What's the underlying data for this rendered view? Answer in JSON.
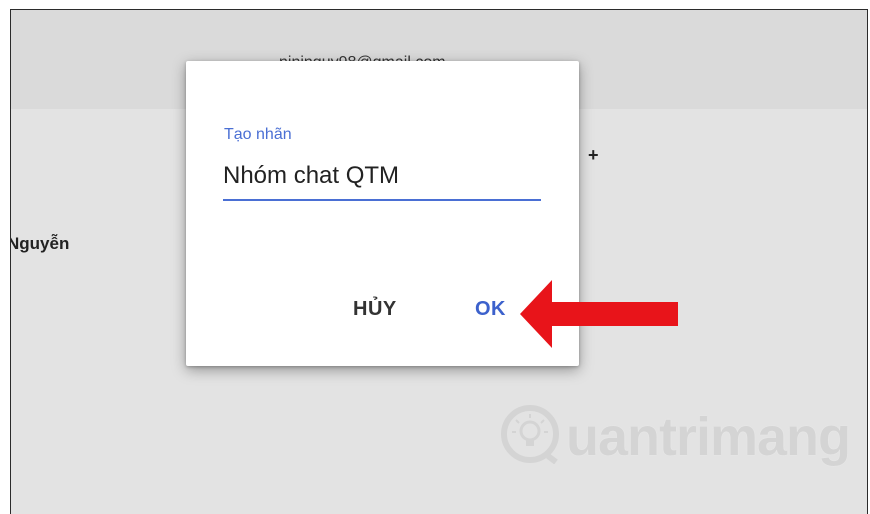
{
  "background": {
    "account_email": "ninjnguy98@gmail.com",
    "add_symbol": "+",
    "contact_name": "Nguyễn"
  },
  "dialog": {
    "label": "Tạo nhãn",
    "input_value": "Nhóm chat QTM",
    "cancel_label": "HỦY",
    "ok_label": "OK"
  },
  "watermark": {
    "text": "uantrimang",
    "icon": "lightbulb-icon"
  },
  "annotation": {
    "icon": "red-arrow-icon",
    "color": "#e8141a"
  },
  "colors": {
    "accent": "#4a6fd4",
    "ok_button": "#3c61cc"
  }
}
